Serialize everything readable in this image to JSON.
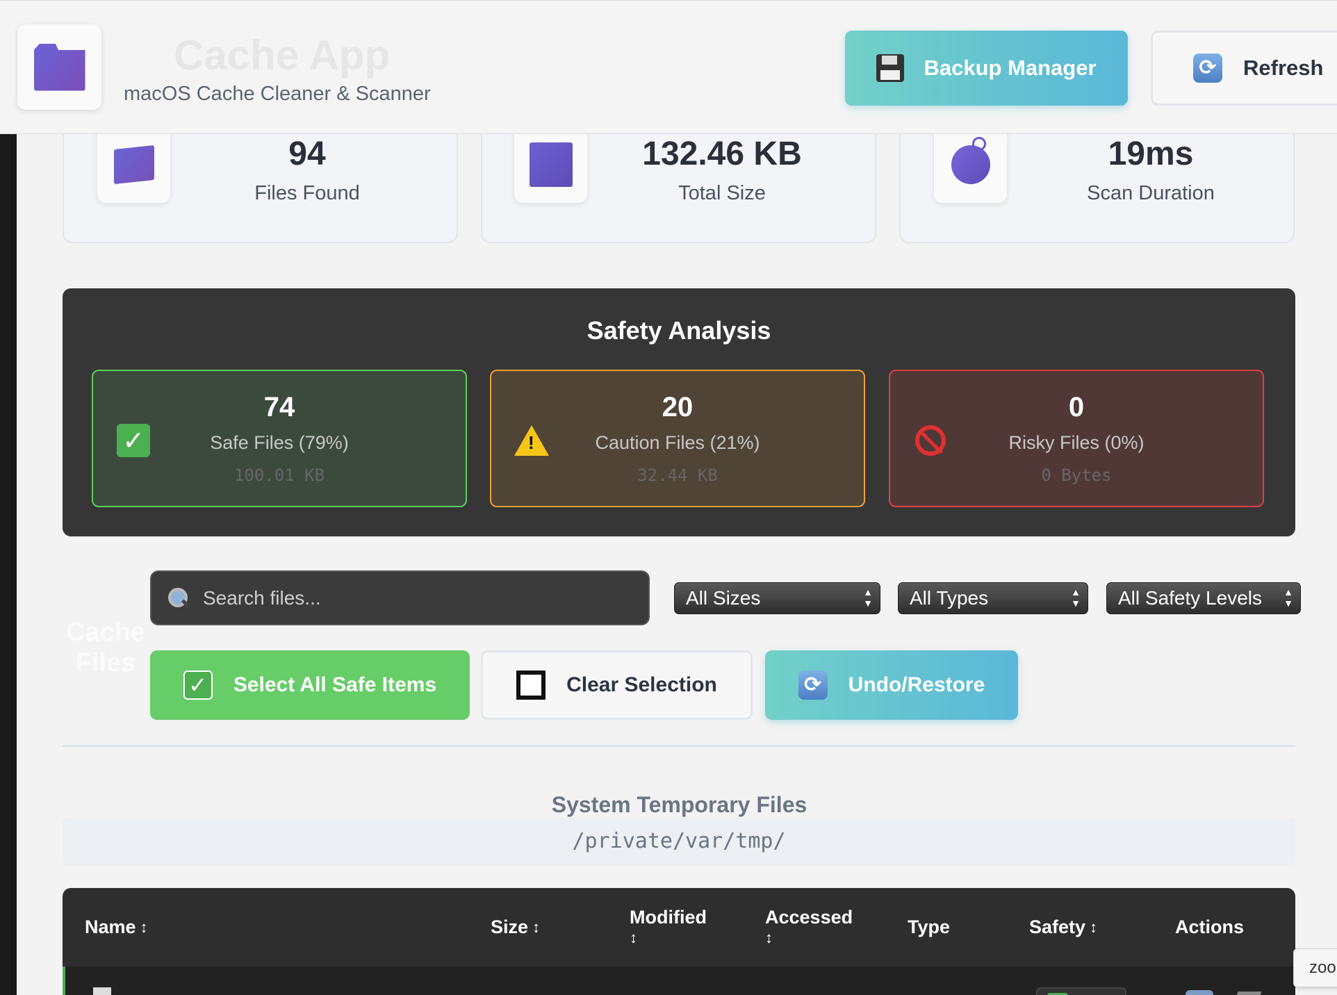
{
  "header": {
    "title": "Cache App",
    "subtitle": "macOS Cache Cleaner & Scanner",
    "backup_label": "Backup Manager",
    "refresh_label": "Refresh"
  },
  "stats": [
    {
      "value": "94",
      "label": "Files Found",
      "icon": "folder-icon"
    },
    {
      "value": "132.46 KB",
      "label": "Total Size",
      "icon": "disk-icon"
    },
    {
      "value": "19ms",
      "label": "Scan Duration",
      "icon": "bomb-icon"
    }
  ],
  "safety": {
    "title": "Safety Analysis",
    "safe": {
      "count": "74",
      "label": "Safe Files (79%)",
      "size": "100.01 KB",
      "color": "#5ccf60"
    },
    "caution": {
      "count": "20",
      "label": "Caution Files (21%)",
      "size": "32.44 KB",
      "color": "#f0a030"
    },
    "risky": {
      "count": "0",
      "label": "Risky Files (0%)",
      "size": "0 Bytes",
      "color": "#dd4040"
    }
  },
  "filters": {
    "side_label": "Cache Files",
    "search_placeholder": "Search files...",
    "size_select": "All Sizes",
    "type_select": "All Types",
    "safety_select": "All Safety Levels"
  },
  "actions": {
    "select_safe": "Select All Safe Items",
    "clear": "Clear Selection",
    "undo": "Undo/Restore"
  },
  "category": {
    "title": "System Temporary Files",
    "path": "/private/var/tmp/"
  },
  "table": {
    "columns": [
      {
        "label": "Name",
        "sort": "↕"
      },
      {
        "label": "Size",
        "sort": "↕"
      },
      {
        "label": "Modified",
        "sort": "↕"
      },
      {
        "label": "Accessed",
        "sort": "↕"
      },
      {
        "label": "Type",
        "sort": ""
      },
      {
        "label": "Safety",
        "sort": "↕"
      },
      {
        "label": "Actions",
        "sort": ""
      }
    ]
  },
  "zoom_tip": "zoo"
}
